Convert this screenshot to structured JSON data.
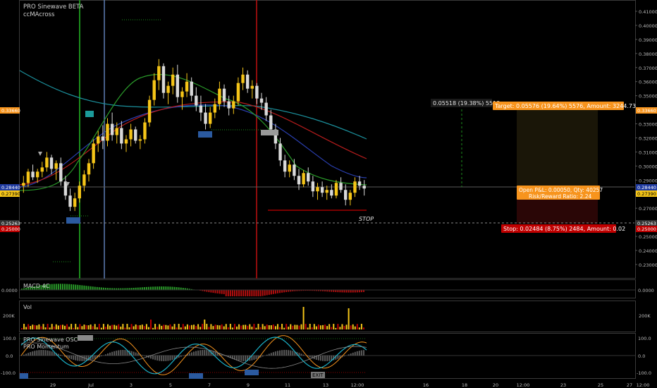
{
  "main_pane": {
    "indicator_title": "PRO Sinewave BETA",
    "indicator_subtitle": "ccMAcross",
    "price_ticks": [
      "0.41000",
      "0.40000",
      "0.39000",
      "0.38000",
      "0.37000",
      "0.36000",
      "0.35000",
      "0.34000",
      "0.33000",
      "0.32000",
      "0.31000",
      "0.30000",
      "0.29000",
      "0.28000",
      "0.27000",
      "0.26000",
      "0.25000",
      "0.24000",
      "0.23000"
    ],
    "left_badges": {
      "target": "0.33660",
      "current": "0.28440",
      "current2": "0.27390",
      "stop1": "0.25263",
      "stop2": "0.25000"
    },
    "right_badges": {
      "target": "0.33660",
      "current": "0.28440",
      "current2": "0.27390",
      "stop1": "0.25263",
      "stop2": "0.25000"
    },
    "projection_label": "0.05518 (19.38%) 5518",
    "target_label": "Target: 0.05576 (19.64%) 5576, Amount: 3244.73",
    "position_label_1": "Open P&L: 0.00050, Qty: 40257",
    "position_label_2": "Risk/Reward Ratio: 2.24",
    "stop_label": "Stop: 0.02484 (8.75%) 2484, Amount: 0.02",
    "stop_tag": "STOP"
  },
  "macd_pane": {
    "title": "MACD 4C",
    "tick": "0.0000"
  },
  "vol_pane": {
    "title": "Vol",
    "tick": "200K"
  },
  "osc_pane": {
    "title": "PRO Sinewave OSC",
    "subtitle": "PRO Momentum",
    "ticks": [
      "100.0",
      "0.0",
      "-100.0"
    ],
    "exit_tag": "EXIT"
  },
  "time_axis": [
    "29",
    "Jul",
    "3",
    "5",
    "7",
    "9",
    "11",
    "13",
    "12:00",
    "16",
    "18",
    "20",
    "12:00",
    "23",
    "25",
    "27",
    "12:00"
  ],
  "colors": {
    "up": "#f5c518",
    "down": "#d9d9d9",
    "target_green": "#1c8c1c",
    "stop_red": "#c00000",
    "accent_orange": "#f7941d"
  },
  "chart_data": {
    "type": "candlestick",
    "yaxis_range": [
      0.225,
      0.415
    ],
    "ohlc": [
      [
        0.286,
        0.293,
        0.281,
        0.288
      ],
      [
        0.288,
        0.298,
        0.285,
        0.296
      ],
      [
        0.296,
        0.301,
        0.29,
        0.292
      ],
      [
        0.292,
        0.298,
        0.288,
        0.296
      ],
      [
        0.296,
        0.303,
        0.292,
        0.299
      ],
      [
        0.299,
        0.31,
        0.296,
        0.306
      ],
      [
        0.306,
        0.308,
        0.294,
        0.298
      ],
      [
        0.298,
        0.304,
        0.29,
        0.302
      ],
      [
        0.302,
        0.306,
        0.286,
        0.289
      ],
      [
        0.289,
        0.293,
        0.276,
        0.279
      ],
      [
        0.279,
        0.284,
        0.268,
        0.271
      ],
      [
        0.271,
        0.281,
        0.268,
        0.277
      ],
      [
        0.277,
        0.289,
        0.274,
        0.286
      ],
      [
        0.286,
        0.297,
        0.282,
        0.294
      ],
      [
        0.294,
        0.305,
        0.289,
        0.302
      ],
      [
        0.302,
        0.319,
        0.298,
        0.316
      ],
      [
        0.316,
        0.325,
        0.31,
        0.321
      ],
      [
        0.321,
        0.329,
        0.312,
        0.318
      ],
      [
        0.318,
        0.334,
        0.314,
        0.33
      ],
      [
        0.33,
        0.338,
        0.318,
        0.322
      ],
      [
        0.322,
        0.331,
        0.316,
        0.327
      ],
      [
        0.327,
        0.332,
        0.312,
        0.316
      ],
      [
        0.316,
        0.322,
        0.31,
        0.319
      ],
      [
        0.319,
        0.33,
        0.314,
        0.326
      ],
      [
        0.326,
        0.328,
        0.316,
        0.318
      ],
      [
        0.318,
        0.322,
        0.312,
        0.319
      ],
      [
        0.319,
        0.334,
        0.316,
        0.331
      ],
      [
        0.331,
        0.35,
        0.328,
        0.347
      ],
      [
        0.347,
        0.366,
        0.343,
        0.361
      ],
      [
        0.361,
        0.376,
        0.354,
        0.371
      ],
      [
        0.371,
        0.373,
        0.348,
        0.352
      ],
      [
        0.352,
        0.36,
        0.344,
        0.357
      ],
      [
        0.357,
        0.37,
        0.351,
        0.365
      ],
      [
        0.365,
        0.372,
        0.345,
        0.349
      ],
      [
        0.349,
        0.356,
        0.34,
        0.353
      ],
      [
        0.353,
        0.366,
        0.349,
        0.36
      ],
      [
        0.36,
        0.363,
        0.346,
        0.35
      ],
      [
        0.35,
        0.356,
        0.339,
        0.343
      ],
      [
        0.343,
        0.35,
        0.332,
        0.338
      ],
      [
        0.338,
        0.344,
        0.326,
        0.33
      ],
      [
        0.33,
        0.342,
        0.327,
        0.338
      ],
      [
        0.338,
        0.348,
        0.334,
        0.344
      ],
      [
        0.344,
        0.36,
        0.34,
        0.355
      ],
      [
        0.355,
        0.358,
        0.342,
        0.346
      ],
      [
        0.346,
        0.35,
        0.336,
        0.341
      ],
      [
        0.341,
        0.35,
        0.337,
        0.346
      ],
      [
        0.346,
        0.363,
        0.343,
        0.359
      ],
      [
        0.359,
        0.37,
        0.354,
        0.365
      ],
      [
        0.365,
        0.368,
        0.352,
        0.355
      ],
      [
        0.355,
        0.361,
        0.348,
        0.357
      ],
      [
        0.357,
        0.359,
        0.344,
        0.348
      ],
      [
        0.348,
        0.352,
        0.34,
        0.345
      ],
      [
        0.345,
        0.349,
        0.332,
        0.336
      ],
      [
        0.336,
        0.34,
        0.322,
        0.326
      ],
      [
        0.326,
        0.33,
        0.312,
        0.316
      ],
      [
        0.316,
        0.32,
        0.3,
        0.304
      ],
      [
        0.304,
        0.308,
        0.292,
        0.296
      ],
      [
        0.296,
        0.304,
        0.292,
        0.301
      ],
      [
        0.301,
        0.305,
        0.29,
        0.293
      ],
      [
        0.293,
        0.298,
        0.283,
        0.287
      ],
      [
        0.287,
        0.297,
        0.285,
        0.295
      ],
      [
        0.295,
        0.299,
        0.286,
        0.289
      ],
      [
        0.289,
        0.293,
        0.278,
        0.282
      ],
      [
        0.282,
        0.288,
        0.276,
        0.285
      ],
      [
        0.285,
        0.289,
        0.278,
        0.281
      ],
      [
        0.281,
        0.286,
        0.276,
        0.283
      ],
      [
        0.283,
        0.287,
        0.277,
        0.279
      ],
      [
        0.279,
        0.29,
        0.277,
        0.288
      ],
      [
        0.288,
        0.292,
        0.281,
        0.283
      ],
      [
        0.283,
        0.287,
        0.272,
        0.276
      ],
      [
        0.276,
        0.283,
        0.272,
        0.281
      ],
      [
        0.281,
        0.292,
        0.278,
        0.289
      ],
      [
        0.289,
        0.293,
        0.283,
        0.286
      ],
      [
        0.286,
        0.29,
        0.279,
        0.284
      ]
    ]
  }
}
